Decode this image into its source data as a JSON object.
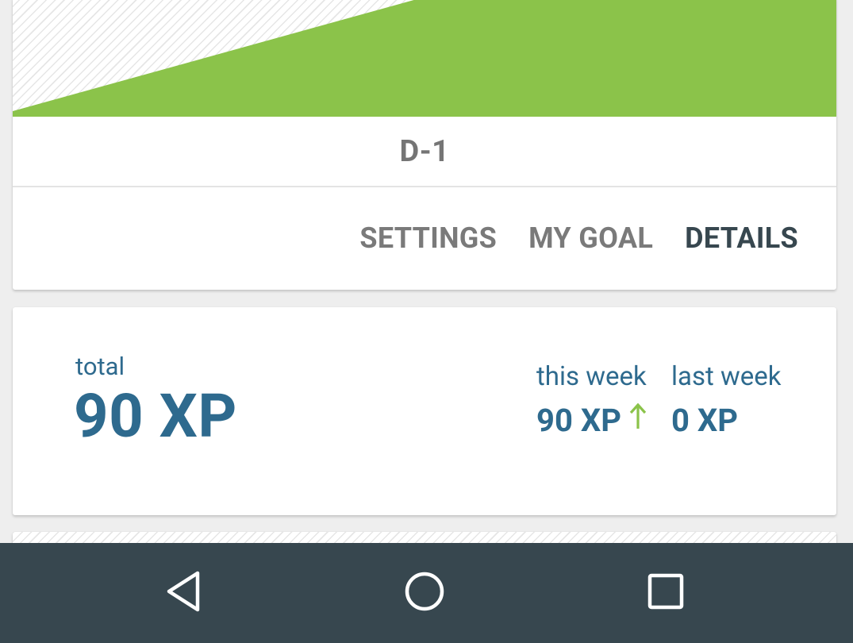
{
  "chart": {
    "fill_color": "#8bc34a",
    "hatch_color": "#e6e6e6"
  },
  "deck": {
    "title": "D-1"
  },
  "actions": {
    "settings_label": "SETTINGS",
    "goal_label": "MY GOAL",
    "details_label": "DETAILS"
  },
  "xp": {
    "total_label": "total",
    "total_value": "90 XP",
    "this_week_label": "this week",
    "this_week_value": "90 XP",
    "trend_icon": "arrow-up-icon",
    "last_week_label": "last week",
    "last_week_value": "0 XP"
  },
  "colors": {
    "accent_text": "#2e6a8e",
    "trend_up": "#8bc34a",
    "navbar": "#37474f"
  },
  "navbar": {
    "back_icon": "back-triangle-icon",
    "home_icon": "home-circle-icon",
    "recents_icon": "recents-square-icon"
  }
}
